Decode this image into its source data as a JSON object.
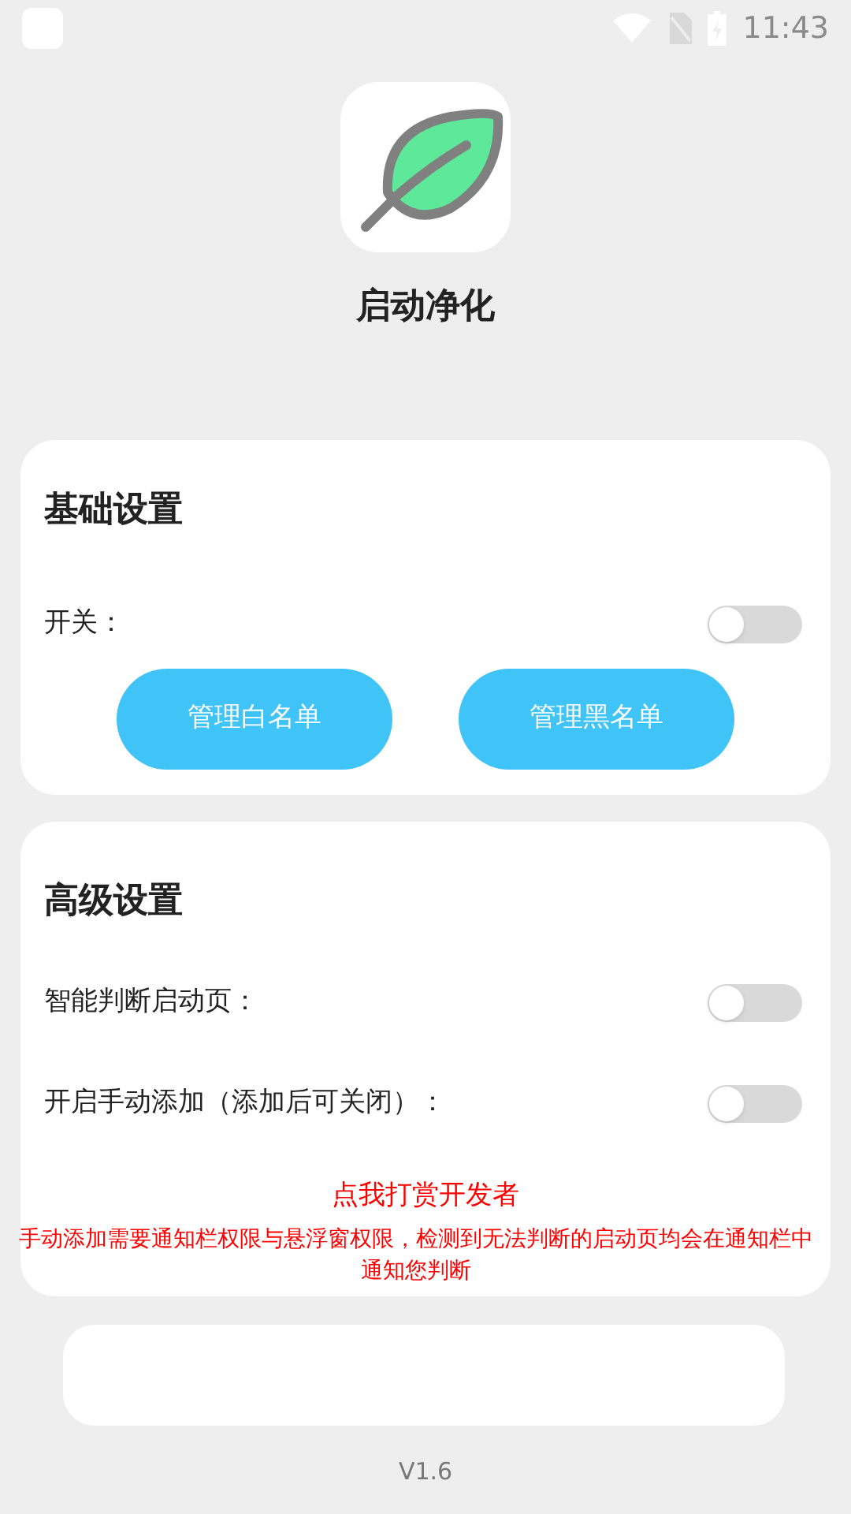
{
  "status_bar": {
    "time": "11:43"
  },
  "app": {
    "title": "启动净化"
  },
  "basic": {
    "title": "基础设置",
    "switches": [
      {
        "label": "开关：",
        "on": false
      }
    ],
    "buttons": [
      "管理白名单",
      "管理黑名单"
    ]
  },
  "advanced": {
    "title": "高级设置",
    "switches": [
      {
        "label": "智能判断启动页：",
        "on": false
      },
      {
        "label": "开启手动添加（添加后可关闭）：",
        "on": false
      }
    ],
    "donate_link": "点我打赏开发者",
    "notice": "手动添加需要通知栏权限与悬浮窗权限，检测到无法判断的启动页均会在通知栏中通知您判断"
  },
  "version": "V1.6"
}
